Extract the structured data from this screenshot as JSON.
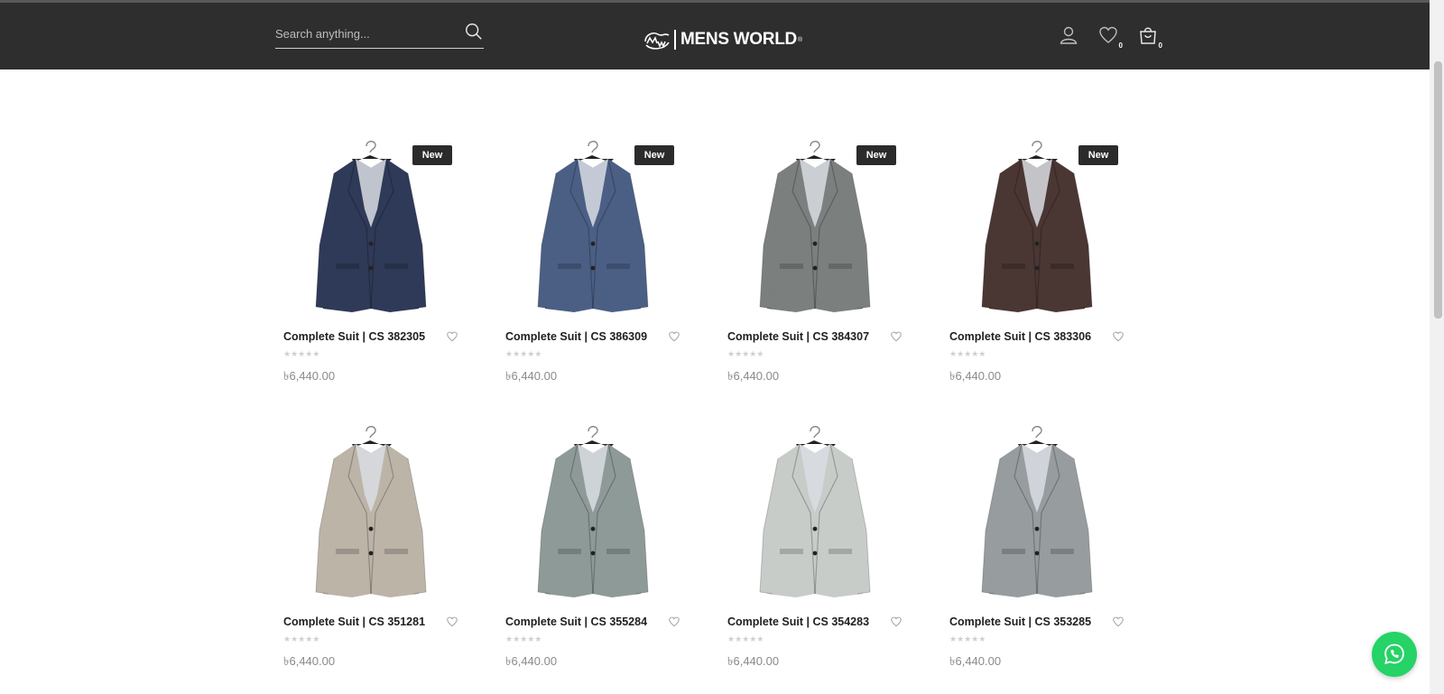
{
  "header": {
    "search_placeholder": "Search anything...",
    "logo_text": "MENS WORLD",
    "logo_reg": "®",
    "wishlist_count": "0",
    "cart_count": "0",
    "background": "#2e2e2e"
  },
  "products": [
    {
      "title": "Complete Suit | CS 382305",
      "price": "৳6,440.00",
      "badge": "New",
      "color": "#2e3a57",
      "stars": "★★★★★"
    },
    {
      "title": "Complete Suit | CS 386309",
      "price": "৳6,440.00",
      "badge": "New",
      "color": "#4b5f85",
      "stars": "★★★★★"
    },
    {
      "title": "Complete Suit | CS 384307",
      "price": "৳6,440.00",
      "badge": "New",
      "color": "#7b7f7d",
      "stars": "★★★★★"
    },
    {
      "title": "Complete Suit | CS 383306",
      "price": "৳6,440.00",
      "badge": "New",
      "color": "#4a3633",
      "stars": "★★★★★"
    },
    {
      "title": "Complete Suit | CS 351281",
      "price": "৳6,440.00",
      "badge": "",
      "color": "#bdb4a8",
      "stars": "★★★★★"
    },
    {
      "title": "Complete Suit | CS 355284",
      "price": "৳6,440.00",
      "badge": "",
      "color": "#8e9a98",
      "stars": "★★★★★"
    },
    {
      "title": "Complete Suit | CS 354283",
      "price": "৳6,440.00",
      "badge": "",
      "color": "#c8ccc9",
      "stars": "★★★★★"
    },
    {
      "title": "Complete Suit | CS 353285",
      "price": "৳6,440.00",
      "badge": "",
      "color": "#979c9f",
      "stars": "★★★★★"
    }
  ],
  "icons": {
    "search": "search-icon",
    "account": "user-icon",
    "wishlist": "heart-icon",
    "cart": "shopping-bag-icon",
    "chat": "whatsapp-icon"
  },
  "accent": "#25d366"
}
